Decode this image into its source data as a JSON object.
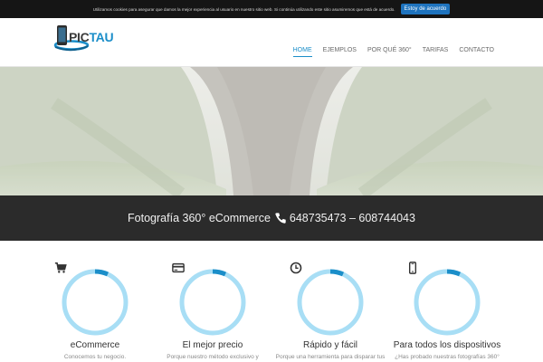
{
  "cookie": {
    "text": "Utilizamos cookies para asegurar que damos la mejor experiencia al usuario en nuestro sitio web. Si continúa utilizando este sitio asumiremos que está de acuerdo.",
    "button": "Estoy de acuerdo"
  },
  "logo": {
    "part1": "PIC",
    "part2": "TAU"
  },
  "nav": {
    "items": [
      "HOME",
      "EJEMPLOS",
      "POR QUÉ 360°",
      "TARIFAS",
      "CONTACTO"
    ],
    "active": "HOME"
  },
  "band": {
    "text_before": "Fotografía 360° eCommerce",
    "phones": "648735473 – 608744043"
  },
  "features": [
    {
      "title": "eCommerce",
      "desc": "Conocemos tu negocio.",
      "icon": "cart-icon"
    },
    {
      "title": "El mejor precio",
      "desc": "Porque nuestro método exclusivo y",
      "icon": "credit-card-icon"
    },
    {
      "title": "Rápido y fácil",
      "desc": "Porque una herramienta para disparar tus",
      "icon": "clock-icon"
    },
    {
      "title": "Para todos los dispositivos",
      "desc": "¿Has probado nuestras fotografías 360°",
      "icon": "mobile-icon"
    }
  ],
  "colors": {
    "accent": "#1b8ec9",
    "ring": "#a8def5",
    "band": "#2b2b2b",
    "cookie_button": "#1e73be"
  }
}
